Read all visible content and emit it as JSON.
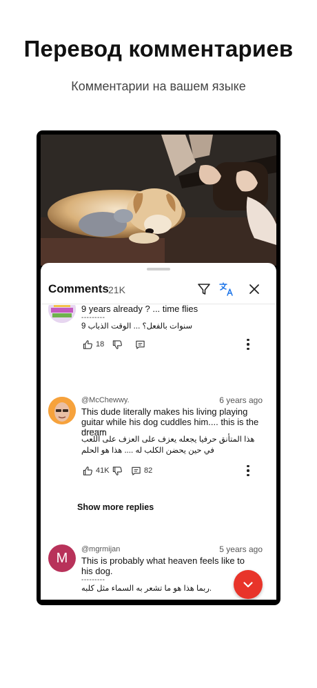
{
  "promo": {
    "title": "Перевод комментариев",
    "subtitle": "Комментарии на вашем языке"
  },
  "sheet": {
    "title": "Comments",
    "count": "21K",
    "icons": [
      "filter-icon",
      "translate-icon",
      "close-icon"
    ]
  },
  "comments": [
    {
      "author": "",
      "time": "",
      "text": "9 years already ? ... time flies",
      "separator": "---------",
      "translation": "سنوات بالفعل؟ ... الوقت الذباب 9",
      "likes": "18",
      "replies": ""
    },
    {
      "author": "@McChewwy.",
      "time": "6 years ago",
      "text": "This dude literally makes his living playing guitar while his dog cuddles him.... this is the dream",
      "separator": "---------",
      "translation": "هذا المتأنق حرفيا يجعله يعزف على العزف على اللعب في حين يحضن الكلب له .... هذا هو الحلم",
      "likes": "41K",
      "replies": "82",
      "show_more": "Show more replies"
    },
    {
      "author": "@mgrmijan",
      "avatar_letter": "M",
      "time": "5 years ago",
      "text": "This is probably what heaven feels like to his dog.",
      "separator": "---------",
      "translation": ".ربما هذا هو ما تشعر به السماء مثل كلبه"
    }
  ],
  "colors": {
    "accent": "#e8342a",
    "avatar_m": "#b8325a"
  }
}
